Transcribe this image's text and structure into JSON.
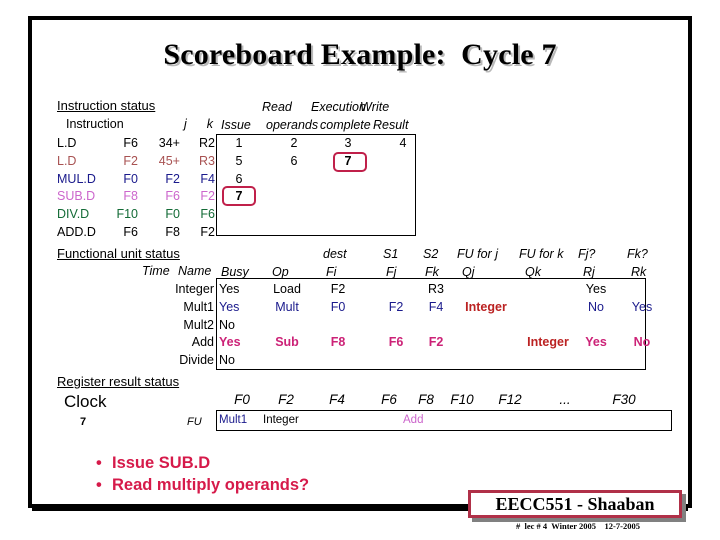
{
  "slide": {
    "title": "Scoreboard Example:  Cycle 7"
  },
  "instruction_status": {
    "section_label": "Instruction status",
    "headers": {
      "instruction": "Instruction",
      "j": "j",
      "k": "k",
      "issue": "Issue",
      "read_top": "Read",
      "read_bottom": "operands",
      "exec_top": "Execution",
      "exec_bottom": "complete",
      "write_top": "Write",
      "write_bottom": "Result"
    },
    "rows": [
      {
        "op": "L.D",
        "dest": "F6",
        "j": "34+",
        "k": "R2",
        "issue": "1",
        "read": "2",
        "exec": "3",
        "write": "4",
        "color": "#000000"
      },
      {
        "op": "L.D",
        "dest": "F2",
        "j": "45+",
        "k": "R3",
        "issue": "5",
        "read": "6",
        "exec": "7",
        "write": "",
        "color": "#a85252"
      },
      {
        "op": "MUL.D",
        "dest": "F0",
        "j": "F2",
        "k": "F4",
        "issue": "6",
        "read": "",
        "exec": "",
        "write": "",
        "color": "#1a1a8c"
      },
      {
        "op": "SUB.D",
        "dest": "F8",
        "j": "F6",
        "k": "F2",
        "issue": "7",
        "read": "",
        "exec": "",
        "write": "",
        "color": "#cc66cc"
      },
      {
        "op": "DIV.D",
        "dest": "F10",
        "j": "F0",
        "k": "F6",
        "issue": "",
        "read": "",
        "exec": "",
        "write": "",
        "color": "#136b36"
      },
      {
        "op": "ADD.D",
        "dest": "F6",
        "j": "F8",
        "k": "F2",
        "issue": "",
        "read": "",
        "exec": "",
        "write": "",
        "color": "#000000"
      }
    ]
  },
  "functional_unit_status": {
    "section_label": "Functional unit status",
    "headers": {
      "time": "Time",
      "name": "Name",
      "busy": "Busy",
      "op": "Op",
      "dest_top": "dest",
      "fi": "Fi",
      "s1_top": "S1",
      "fj": "Fj",
      "s2_top": "S2",
      "fk": "Fk",
      "fu_for_j_top": "FU for j",
      "qj": "Qj",
      "fu_for_k_top": "FU for k",
      "qk": "Qk",
      "fj_q_top": "Fj?",
      "rj": "Rj",
      "fk_q_top": "Fk?",
      "rk": "Rk"
    },
    "rows": [
      {
        "time": "",
        "name": "Integer",
        "busy": "Yes",
        "op": "Load",
        "fi": "F2",
        "fj": "",
        "fk": "R3",
        "qj": "",
        "qk": "",
        "rj": "Yes",
        "rk": "",
        "color": "#000000",
        "bold": false
      },
      {
        "time": "",
        "name": "Mult1",
        "busy": "Yes",
        "op": "Mult",
        "fi": "F0",
        "fj": "F2",
        "fk": "F4",
        "qj": "Integer",
        "qk": "",
        "rj": "No",
        "rk": "Yes",
        "color": "#1a1a8c",
        "bold": false,
        "qj_color": "#bb2222",
        "qj_bold": true
      },
      {
        "time": "",
        "name": "Mult2",
        "busy": "No",
        "op": "",
        "fi": "",
        "fj": "",
        "fk": "",
        "qj": "",
        "qk": "",
        "rj": "",
        "rk": "",
        "color": "#000000",
        "bold": false
      },
      {
        "time": "",
        "name": "Add",
        "busy": "Yes",
        "op": "Sub",
        "fi": "F8",
        "fj": "F6",
        "fk": "F2",
        "qj": "",
        "qk": "Integer",
        "rj": "Yes",
        "rk": "No",
        "color": "#cc2277",
        "bold": true,
        "qk_color": "#bb2222",
        "qk_bold": true
      },
      {
        "time": "",
        "name": "Divide",
        "busy": "No",
        "op": "",
        "fi": "",
        "fj": "",
        "fk": "",
        "qj": "",
        "qk": "",
        "rj": "",
        "rk": "",
        "color": "#000000",
        "bold": false
      }
    ]
  },
  "register_result_status": {
    "section_label": "Register result status",
    "clock_label": "Clock",
    "clock_value": "7",
    "fu_label": "FU",
    "registers": [
      "F0",
      "F2",
      "F4",
      "F6",
      "F8",
      "F10",
      "F12",
      "...",
      "F30"
    ],
    "values": [
      {
        "reg": "F0",
        "value": "Mult1",
        "color": "#1a1a8c"
      },
      {
        "reg": "F2",
        "value": "Integer",
        "color": "#000000"
      },
      {
        "reg": "F4",
        "value": "",
        "color": "#000000"
      },
      {
        "reg": "F6",
        "value": "",
        "color": "#000000"
      },
      {
        "reg": "F8",
        "value": "Add",
        "color": "#cc66cc"
      },
      {
        "reg": "F10",
        "value": "",
        "color": "#000000"
      },
      {
        "reg": "F12",
        "value": "",
        "color": "#000000"
      },
      {
        "reg": "...",
        "value": "",
        "color": "#000000"
      },
      {
        "reg": "F30",
        "value": "",
        "color": "#000000"
      }
    ]
  },
  "bullets": [
    "Issue SUB.D",
    "Read multiply operands?"
  ],
  "footer": {
    "badge": "EECC551 - Shaaban",
    "sub": "#  lec # 4  Winter 2005    12-7-2005"
  },
  "colors": {
    "accent_red": "#d61a4a",
    "highlight_border": "#c0204a",
    "badge_border": "#b03048",
    "magenta": "#cc2277",
    "navy": "#1a1a8c",
    "green": "#136b36",
    "brown_red": "#a85252"
  }
}
